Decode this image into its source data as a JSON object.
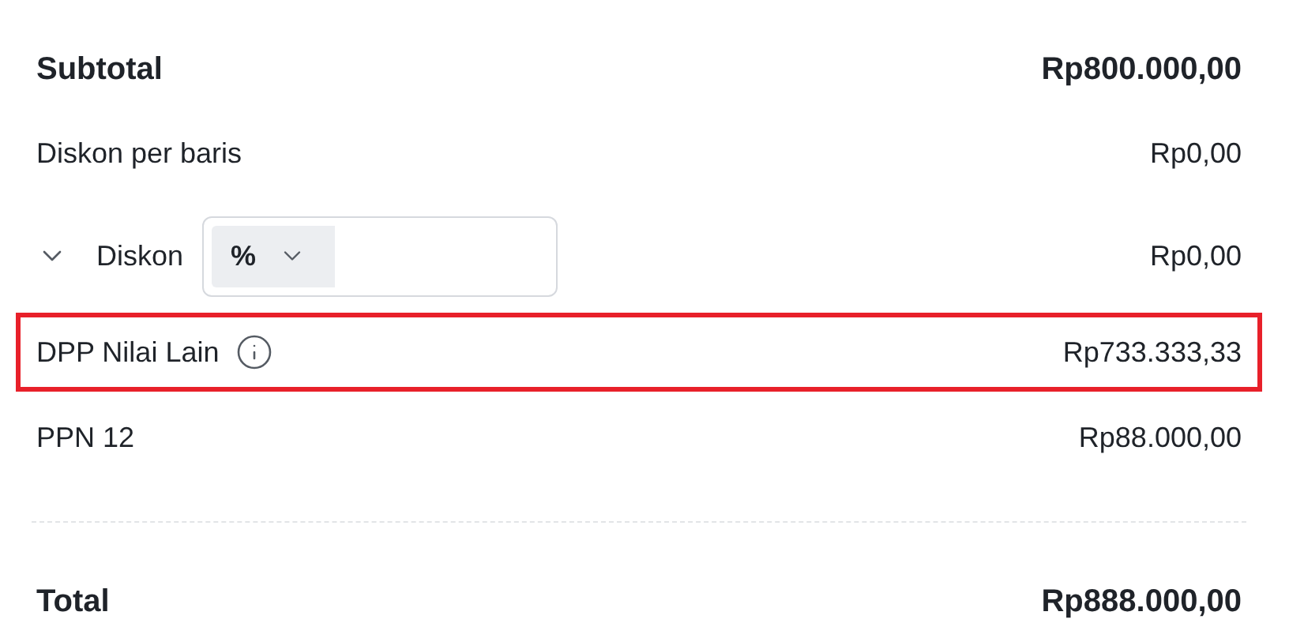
{
  "rows": [
    {
      "kind": "subtotal",
      "label": "Subtotal",
      "amount": "Rp800.000,00",
      "highlighted": false
    },
    {
      "kind": "plain",
      "label": "Diskon per baris",
      "amount": "Rp0,00",
      "highlighted": false
    },
    {
      "kind": "discount",
      "label": "Diskon",
      "expanded": false,
      "unit": "%",
      "amount": "Rp0,00",
      "highlighted": false
    },
    {
      "kind": "info",
      "label": "DPP Nilai Lain",
      "amount": "Rp733.333,33",
      "highlighted": true
    },
    {
      "kind": "plain",
      "label": "PPN 12",
      "amount": "Rp88.000,00",
      "highlighted": false
    }
  ],
  "total": {
    "label": "Total",
    "amount": "Rp888.000,00"
  }
}
